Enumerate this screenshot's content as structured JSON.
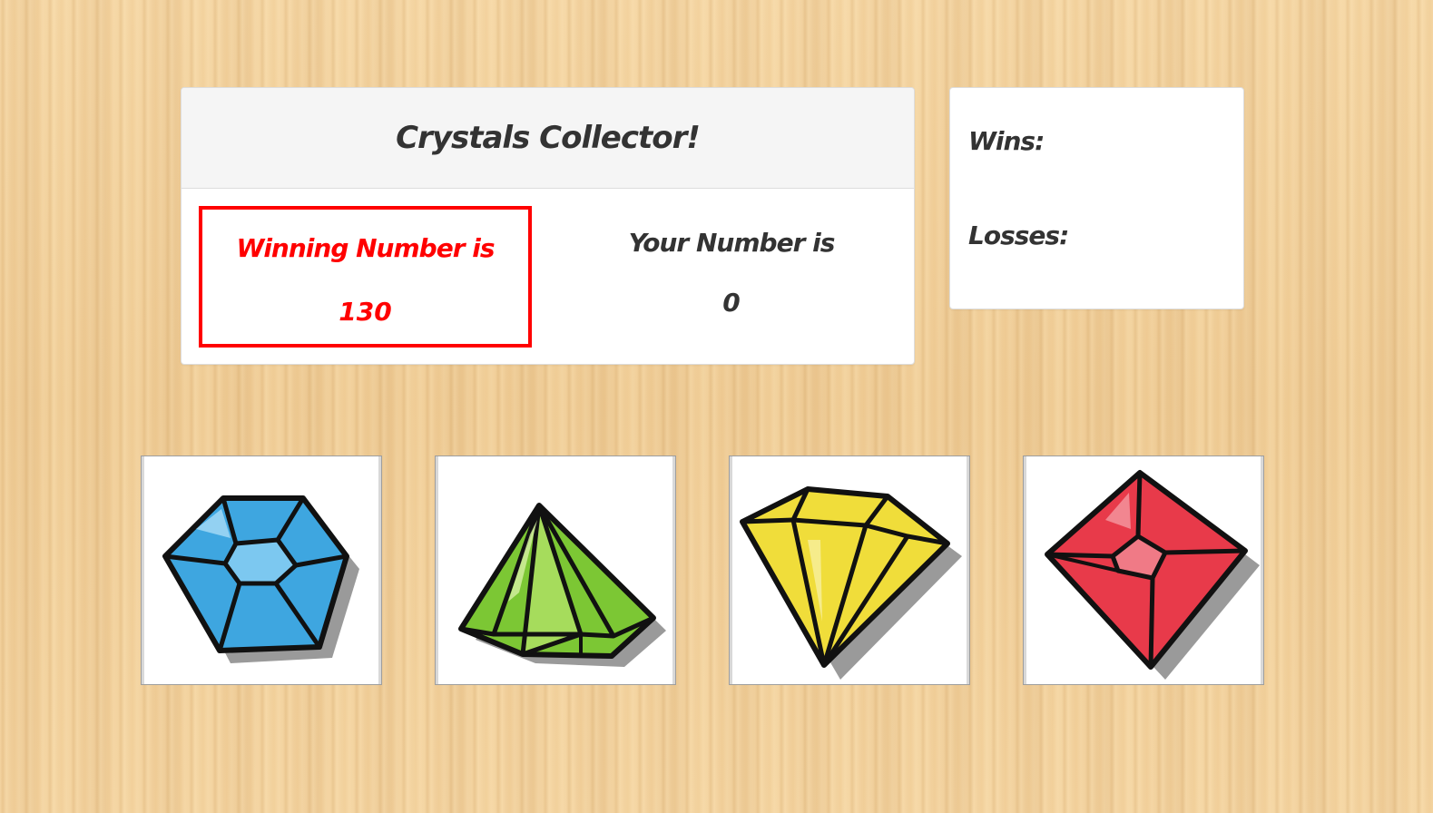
{
  "game": {
    "title": "Crystals Collector!",
    "winning_label": "Winning Number is",
    "winning_number": "130",
    "your_label": "Your Number is",
    "your_number": "0"
  },
  "score": {
    "wins_label": "Wins:",
    "wins_value": "",
    "losses_label": "Losses:",
    "losses_value": ""
  },
  "crystals": [
    {
      "icon": "blue-hexagon-crystal-icon",
      "color": "#3ea6e0"
    },
    {
      "icon": "green-pyramid-crystal-icon",
      "color": "#7cc734"
    },
    {
      "icon": "yellow-diamond-crystal-icon",
      "color": "#f0dd3a"
    },
    {
      "icon": "red-square-crystal-icon",
      "color": "#e83a4a"
    }
  ],
  "colors": {
    "accent_red": "#ff0000",
    "panel_bg": "#ffffff",
    "heading_bg": "#f5f5f5",
    "wood": "#f3d29e"
  }
}
